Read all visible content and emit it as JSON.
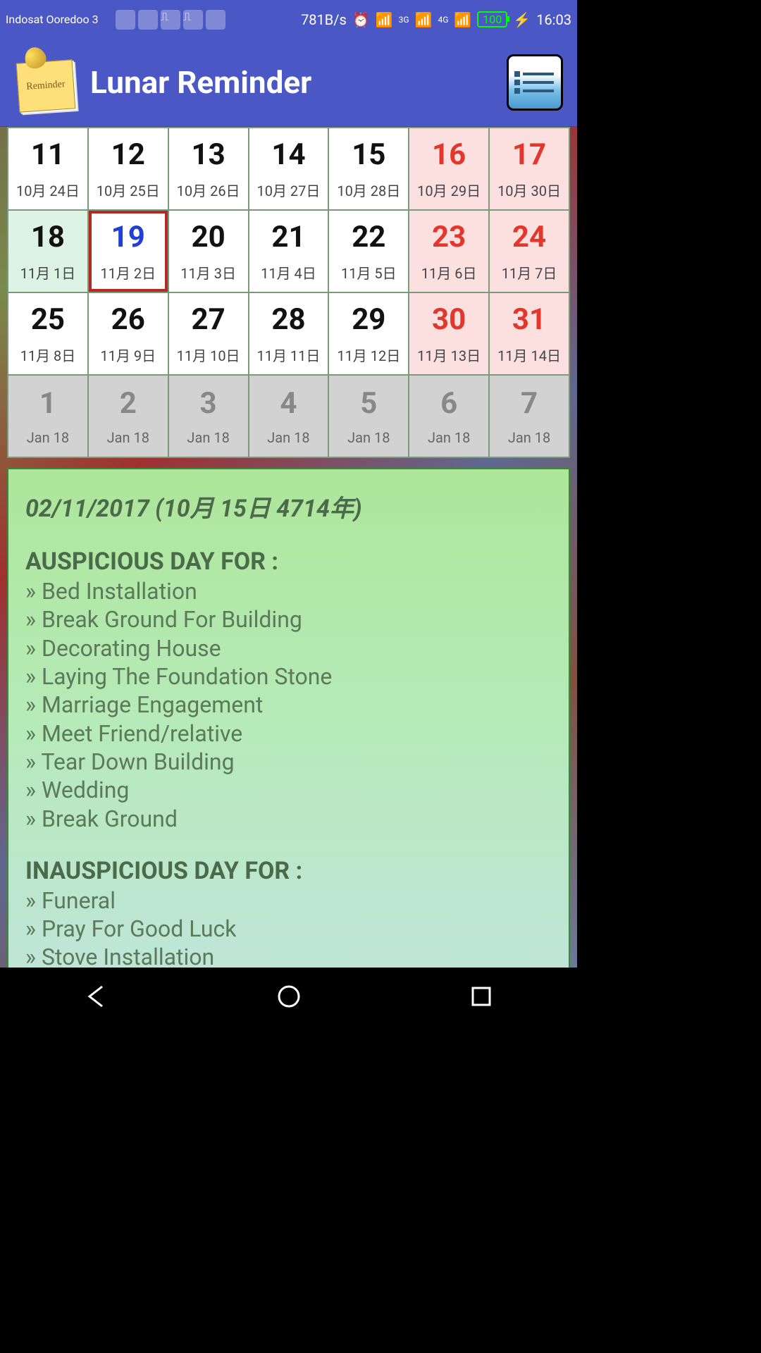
{
  "status_bar": {
    "carrier": "Indosat Ooredoo 3",
    "speed": "781B/s",
    "net1": "3G",
    "net2": "4G",
    "battery": "100",
    "time": "16:03"
  },
  "header": {
    "title": "Lunar Reminder",
    "icon_label": "Reminder"
  },
  "calendar": {
    "rows": [
      [
        {
          "day": "11",
          "lunar": "10月 24日",
          "type": "normal"
        },
        {
          "day": "12",
          "lunar": "10月 25日",
          "type": "normal"
        },
        {
          "day": "13",
          "lunar": "10月 26日",
          "type": "normal"
        },
        {
          "day": "14",
          "lunar": "10月 27日",
          "type": "normal"
        },
        {
          "day": "15",
          "lunar": "10月 28日",
          "type": "normal"
        },
        {
          "day": "16",
          "lunar": "10月 29日",
          "type": "weekend"
        },
        {
          "day": "17",
          "lunar": "10月 30日",
          "type": "weekend"
        }
      ],
      [
        {
          "day": "18",
          "lunar": "11月 1日",
          "type": "special"
        },
        {
          "day": "19",
          "lunar": "11月 2日",
          "type": "selected"
        },
        {
          "day": "20",
          "lunar": "11月 3日",
          "type": "normal"
        },
        {
          "day": "21",
          "lunar": "11月 4日",
          "type": "normal"
        },
        {
          "day": "22",
          "lunar": "11月 5日",
          "type": "normal"
        },
        {
          "day": "23",
          "lunar": "11月 6日",
          "type": "weekend"
        },
        {
          "day": "24",
          "lunar": "11月 7日",
          "type": "weekend"
        }
      ],
      [
        {
          "day": "25",
          "lunar": "11月 8日",
          "type": "normal"
        },
        {
          "day": "26",
          "lunar": "11月 9日",
          "type": "normal"
        },
        {
          "day": "27",
          "lunar": "11月 10日",
          "type": "normal"
        },
        {
          "day": "28",
          "lunar": "11月 11日",
          "type": "normal"
        },
        {
          "day": "29",
          "lunar": "11月 12日",
          "type": "normal"
        },
        {
          "day": "30",
          "lunar": "11月 13日",
          "type": "weekend"
        },
        {
          "day": "31",
          "lunar": "11月 14日",
          "type": "weekend"
        }
      ],
      [
        {
          "day": "1",
          "lunar": "Jan 18",
          "type": "next-month"
        },
        {
          "day": "2",
          "lunar": "Jan 18",
          "type": "next-month"
        },
        {
          "day": "3",
          "lunar": "Jan 18",
          "type": "next-month"
        },
        {
          "day": "4",
          "lunar": "Jan 18",
          "type": "next-month"
        },
        {
          "day": "5",
          "lunar": "Jan 18",
          "type": "next-month"
        },
        {
          "day": "6",
          "lunar": "Jan 18",
          "type": "next-month"
        },
        {
          "day": "7",
          "lunar": "Jan 18",
          "type": "next-month"
        }
      ]
    ]
  },
  "info": {
    "date_solar": "02/11/2017",
    "date_lunar": "10月 15日 4714年",
    "auspicious_title": "AUSPICIOUS DAY FOR :",
    "auspicious": [
      "Bed Installation",
      "Break Ground For Building",
      "Decorating House",
      "Laying The Foundation Stone",
      "Marriage Engagement",
      "Meet Friend/relative",
      "Tear Down Building",
      "Wedding",
      "Break Ground"
    ],
    "inauspicious_title": "INAUSPICIOUS DAY FOR :",
    "inauspicious": [
      "Funeral",
      "Pray For Good Luck",
      "Stove Installation"
    ]
  }
}
